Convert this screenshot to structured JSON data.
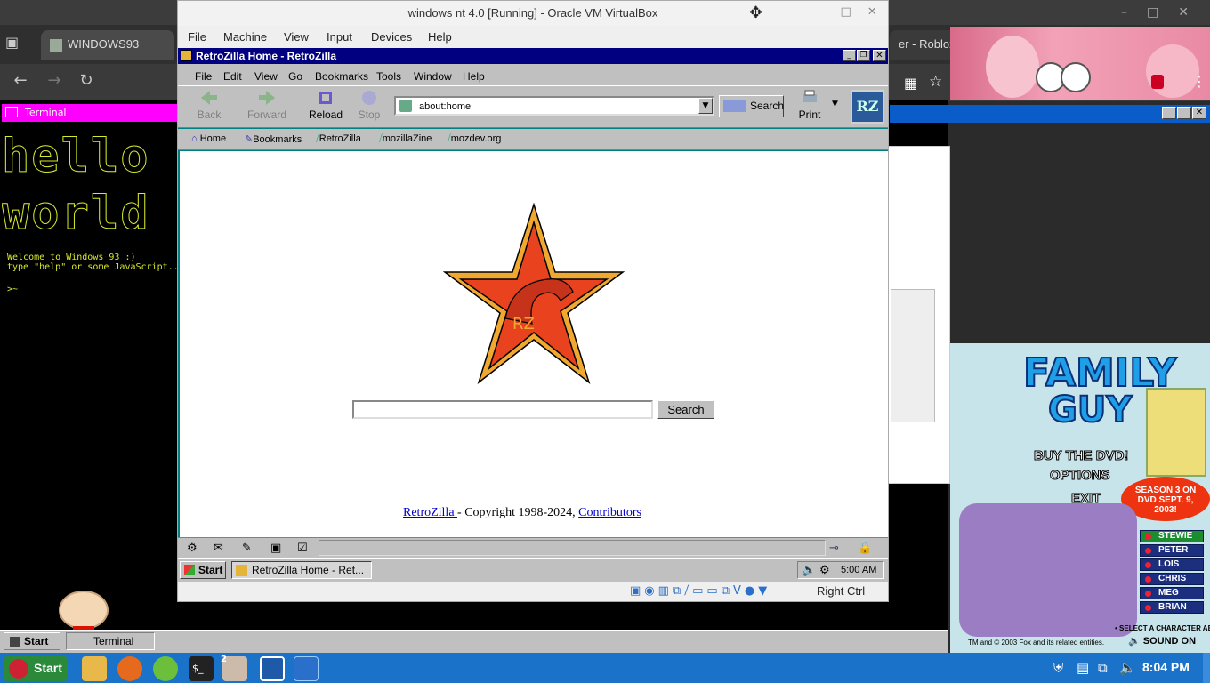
{
  "chrome": {
    "tab_left": "WINDOWS93",
    "tab_right": "er - Roblox on Linux",
    "tab_close": "✕",
    "new_tab": "+"
  },
  "win93": {
    "terminal_title": "Terminal",
    "ascii_line1": "hello",
    "ascii_line2": "world",
    "welcome": "Welcome to Windows 93 :)",
    "hint": "type \"help\" or some JavaScript...",
    "prompt": ">~",
    "start_label": "Start",
    "task_terminal": "Terminal"
  },
  "vbox": {
    "title": "windows nt 4.0 [Running] - Oracle VM VirtualBox",
    "menu": [
      "File",
      "Machine",
      "View",
      "Input",
      "Devices",
      "Help"
    ],
    "host_key": "Right Ctrl"
  },
  "retrozilla": {
    "window_title": "RetroZilla Home - RetroZilla",
    "menu": [
      "File",
      "Edit",
      "View",
      "Go",
      "Bookmarks",
      "Tools",
      "Window",
      "Help"
    ],
    "nav": {
      "back": "Back",
      "forward": "Forward",
      "reload": "Reload",
      "stop": "Stop",
      "print": "Print"
    },
    "url": "about:home",
    "search_button": "Search",
    "personal": [
      "Home",
      "Bookmarks",
      "RetroZilla",
      "mozillaZine",
      "mozdev.org"
    ],
    "page_search_button": "Search",
    "logo_text": "RZ",
    "copyright_link1": "RetroZilla ",
    "copyright_text": " - Copyright 1998-2024, ",
    "copyright_link2": "Contributors"
  },
  "nt": {
    "start_label": "Start",
    "task_label": "RetroZilla Home - Ret...",
    "clock": "5:00 AM"
  },
  "family_guy": {
    "title1": "FAMILY",
    "title2": "GUY",
    "buy": "BUY THE DVD!",
    "options": "OPTIONS",
    "exit": "EXIT",
    "season": "SEASON 3 ON DVD SEPT. 9, 2003!",
    "characters": [
      "STEWIE",
      "PETER",
      "LOIS",
      "CHRIS",
      "MEG",
      "BRIAN"
    ],
    "select_note": "• SELECT A CHARACTER ABOVE",
    "legal": "TM and © 2003 Fox and its related entities.",
    "sound": "SOUND ON"
  },
  "linux_taskbar": {
    "start_label": "Start",
    "badge": "2",
    "clock": "8:04 PM"
  }
}
